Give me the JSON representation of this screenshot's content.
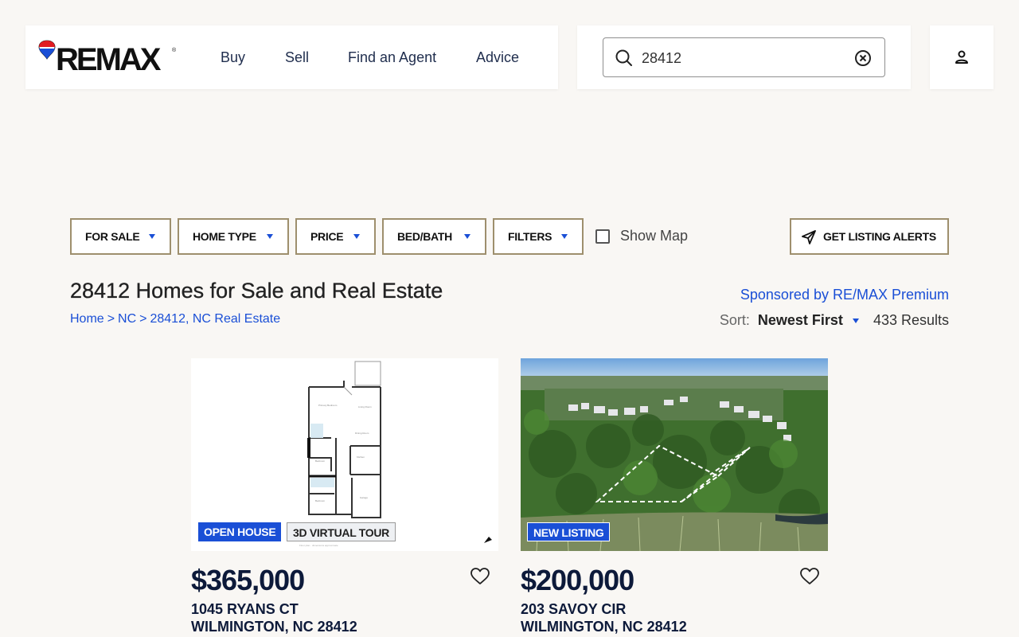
{
  "header": {
    "logo_text": "RE/MAX",
    "logo_display": "REMAX",
    "nav": [
      "Buy",
      "Sell",
      "Find an Agent",
      "Advice"
    ]
  },
  "search": {
    "value": "28412",
    "placeholder": ""
  },
  "filters": {
    "buttons": [
      "FOR SALE",
      "HOME TYPE",
      "PRICE",
      "BED/BATH",
      "FILTERS"
    ],
    "show_map_label": "Show Map",
    "alerts_label": "GET LISTING ALERTS"
  },
  "results": {
    "title": "28412 Homes for Sale and Real Estate",
    "breadcrumb": [
      "Home",
      "NC",
      "28412, NC Real Estate"
    ],
    "sponsored": "Sponsored by RE/MAX Premium",
    "sort_label": "Sort:",
    "sort_value": "Newest First",
    "count": "433 Results"
  },
  "listings": [
    {
      "badges": [
        "OPEN HOUSE",
        "3D VIRTUAL TOUR"
      ],
      "price": "$365,000",
      "street": "1045 RYANS CT",
      "city": "WILMINGTON, NC 28412"
    },
    {
      "badges": [
        "NEW LISTING"
      ],
      "price": "$200,000",
      "street": "203 SAVOY CIR",
      "city": "WILMINGTON, NC 28412"
    }
  ],
  "colors": {
    "accent_blue": "#1a4fd6",
    "filter_border": "#9e8f6d",
    "background": "#f9f7f4"
  }
}
